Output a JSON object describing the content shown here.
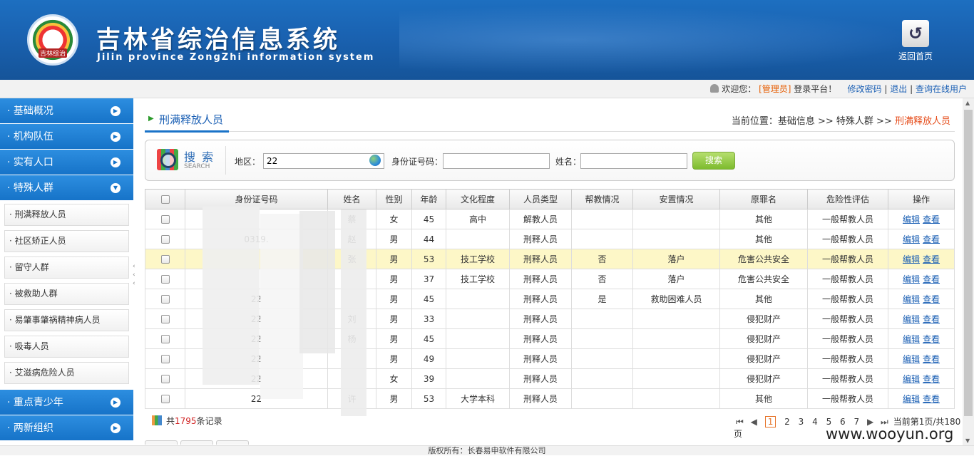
{
  "header": {
    "logo_text": "吉林综治",
    "title": "吉林省综治信息系统",
    "subtitle": "Jilin province ZongZhi information system",
    "home_label": "返回首页"
  },
  "userbar": {
    "welcome": "欢迎您：",
    "role": "[管理员]",
    "login_text": "登录平台！",
    "change_password": "修改密码",
    "sep": "|",
    "logout": "退出",
    "online_users": "查询在线用户"
  },
  "sidebar": {
    "top_items": [
      {
        "label": "· 基础概况"
      },
      {
        "label": "· 机构队伍"
      },
      {
        "label": "· 实有人口"
      },
      {
        "label": "· 特殊人群"
      }
    ],
    "sub_items": [
      {
        "label": "· 刑满释放人员"
      },
      {
        "label": "· 社区矫正人员"
      },
      {
        "label": "· 留守人群"
      },
      {
        "label": "· 被救助人群"
      },
      {
        "label": "· 易肇事肇祸精神病人员"
      },
      {
        "label": "· 吸毒人员"
      },
      {
        "label": "· 艾滋病危险人员"
      }
    ],
    "bottom_items": [
      {
        "label": "· 重点青少年"
      },
      {
        "label": "· 两新组织"
      }
    ]
  },
  "page": {
    "title": "刑满释放人员",
    "breadcrumb_prefix": "当前位置：基础信息 >> 特殊人群 >> ",
    "breadcrumb_current": "刑满释放人员"
  },
  "search": {
    "badge_cn": "搜 索",
    "badge_en": "SEARCH",
    "region_label": "地区：",
    "region_value": "22",
    "id_label": "身份证号码：",
    "id_value": "",
    "name_label": "姓名：",
    "name_value": "",
    "button": "搜索"
  },
  "table": {
    "headers": [
      "",
      "身份证号码",
      "姓名",
      "性别",
      "年龄",
      "文化程度",
      "人员类型",
      "帮教情况",
      "安置情况",
      "原罪名",
      "危险性评估",
      "操作"
    ],
    "rows": [
      {
        "id": "",
        "name": "蔡",
        "gender": "女",
        "age": "45",
        "edu": "高中",
        "type": "解教人员",
        "help": "",
        "place": "",
        "crime": "其他",
        "risk": "一般帮教人员"
      },
      {
        "id": "0319.",
        "name": "赵",
        "gender": "男",
        "age": "44",
        "edu": "",
        "type": "刑释人员",
        "help": "",
        "place": "",
        "crime": "其他",
        "risk": "一般帮教人员"
      },
      {
        "id": "",
        "name": "张",
        "gender": "男",
        "age": "53",
        "edu": "技工学校",
        "type": "刑释人员",
        "help": "否",
        "place": "落户",
        "crime": "危害公共安全",
        "risk": "一般帮教人员"
      },
      {
        "id": "",
        "name": "",
        "gender": "男",
        "age": "37",
        "edu": "技工学校",
        "type": "刑释人员",
        "help": "否",
        "place": "落户",
        "crime": "危害公共安全",
        "risk": "一般帮教人员"
      },
      {
        "id": "22",
        "name": "",
        "gender": "男",
        "age": "45",
        "edu": "",
        "type": "刑释人员",
        "help": "是",
        "place": "救助困难人员",
        "crime": "其他",
        "risk": "一般帮教人员"
      },
      {
        "id": "22",
        "name": "刘",
        "gender": "男",
        "age": "33",
        "edu": "",
        "type": "刑释人员",
        "help": "",
        "place": "",
        "crime": "侵犯财产",
        "risk": "一般帮教人员"
      },
      {
        "id": "22",
        "name": "杨",
        "gender": "男",
        "age": "45",
        "edu": "",
        "type": "刑释人员",
        "help": "",
        "place": "",
        "crime": "侵犯财产",
        "risk": "一般帮教人员"
      },
      {
        "id": "22",
        "name": "",
        "gender": "男",
        "age": "49",
        "edu": "",
        "type": "刑释人员",
        "help": "",
        "place": "",
        "crime": "侵犯财产",
        "risk": "一般帮教人员"
      },
      {
        "id": "22",
        "name": "",
        "gender": "女",
        "age": "39",
        "edu": "",
        "type": "刑释人员",
        "help": "",
        "place": "",
        "crime": "侵犯财产",
        "risk": "一般帮教人员"
      },
      {
        "id": "22",
        "name": "许",
        "gender": "男",
        "age": "53",
        "edu": "大学本科",
        "type": "刑释人员",
        "help": "",
        "place": "",
        "crime": "其他",
        "risk": "一般帮教人员"
      }
    ],
    "edit_label": "编辑",
    "view_label": "查看"
  },
  "footer": {
    "records_prefix": "共",
    "records_count": "1795",
    "records_suffix": "条记录",
    "pages": [
      "1",
      "2",
      "3",
      "4",
      "5",
      "6",
      "7"
    ],
    "page_info": "当前第1页/共180页",
    "copyright": "版权所有：长春易申软件有限公司",
    "watermark": "www.wooyun.org"
  }
}
